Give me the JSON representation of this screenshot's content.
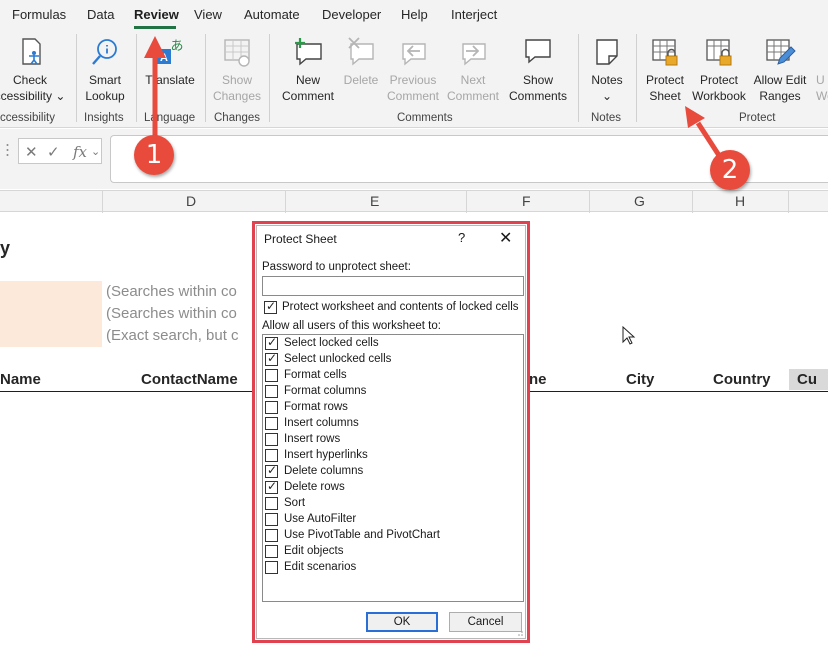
{
  "menu": {
    "tabs": [
      {
        "label": "Formulas"
      },
      {
        "label": "Data"
      },
      {
        "label": "Review",
        "active": true
      },
      {
        "label": "View"
      },
      {
        "label": "Automate"
      },
      {
        "label": "Developer"
      },
      {
        "label": "Help"
      },
      {
        "label": "Interject"
      }
    ]
  },
  "ribbon": {
    "groups": {
      "accessibility": "ccessibility",
      "insights": "Insights",
      "language": "Language",
      "changes": "Changes",
      "comments": "Comments",
      "notes": "Notes",
      "protect": "Protect"
    },
    "buttons": {
      "check_accessibility": [
        "Check",
        "ccessibility"
      ],
      "smart_lookup": [
        "Smart",
        "Lookup"
      ],
      "translate": [
        "Translate"
      ],
      "show_changes": [
        "Show",
        "Changes"
      ],
      "new_comment": [
        "New",
        "Comment"
      ],
      "delete": [
        "Delete"
      ],
      "previous_comment": [
        "Previous",
        "Comment"
      ],
      "next_comment": [
        "Next",
        "Comment"
      ],
      "show_comments": [
        "Show",
        "Comments"
      ],
      "notes": [
        "Notes"
      ],
      "protect_sheet": [
        "Protect",
        "Sheet"
      ],
      "protect_workbook": [
        "Protect",
        "Workbook"
      ],
      "allow_edit_ranges": [
        "Allow Edit",
        "Ranges"
      ],
      "unshare": [
        "U",
        "Wo"
      ]
    },
    "icons": {
      "check_accessibility": "accessibility-icon",
      "smart_lookup": "smart-lookup-icon",
      "translate": "translate-icon",
      "show_changes": "show-changes-icon",
      "new_comment": "new-comment-icon",
      "delete": "delete-comment-icon",
      "previous_comment": "previous-comment-icon",
      "next_comment": "next-comment-icon",
      "show_comments": "show-comments-icon",
      "notes": "notes-icon",
      "protect_sheet": "protect-sheet-icon",
      "protect_workbook": "protect-workbook-icon",
      "allow_edit_ranges": "allow-edit-ranges-icon"
    }
  },
  "formula_bar": {
    "fx": "fx",
    "value": ""
  },
  "columns": [
    "D",
    "E",
    "F",
    "G",
    "H"
  ],
  "sheet": {
    "title_fragment": "y",
    "hints": [
      "(Searches within co",
      "(Searches within co",
      "(Exact search, but c"
    ],
    "headers": [
      "Name",
      "ContactName",
      "ne",
      "City",
      "Country",
      "Cu"
    ]
  },
  "annotations": {
    "badge1": "1",
    "badge2": "2",
    "color": "#e84a3c"
  },
  "dialog": {
    "title": "Protect Sheet",
    "help": "?",
    "close": "✕",
    "password_label": "Password to unprotect sheet:",
    "password_value": "",
    "protect_contents": {
      "label": "Protect worksheet and contents of locked cells",
      "checked": true
    },
    "allow_label": "Allow all users of this worksheet to:",
    "permissions": [
      {
        "label": "Select locked cells",
        "checked": true
      },
      {
        "label": "Select unlocked cells",
        "checked": true
      },
      {
        "label": "Format cells",
        "checked": false
      },
      {
        "label": "Format columns",
        "checked": false
      },
      {
        "label": "Format rows",
        "checked": false
      },
      {
        "label": "Insert columns",
        "checked": false
      },
      {
        "label": "Insert rows",
        "checked": false
      },
      {
        "label": "Insert hyperlinks",
        "checked": false
      },
      {
        "label": "Delete columns",
        "checked": true
      },
      {
        "label": "Delete rows",
        "checked": true
      },
      {
        "label": "Sort",
        "checked": false
      },
      {
        "label": "Use AutoFilter",
        "checked": false
      },
      {
        "label": "Use PivotTable and PivotChart",
        "checked": false
      },
      {
        "label": "Edit objects",
        "checked": false
      },
      {
        "label": "Edit scenarios",
        "checked": false
      }
    ],
    "ok": "OK",
    "cancel": "Cancel",
    "highlight_color": "#e0434f"
  }
}
